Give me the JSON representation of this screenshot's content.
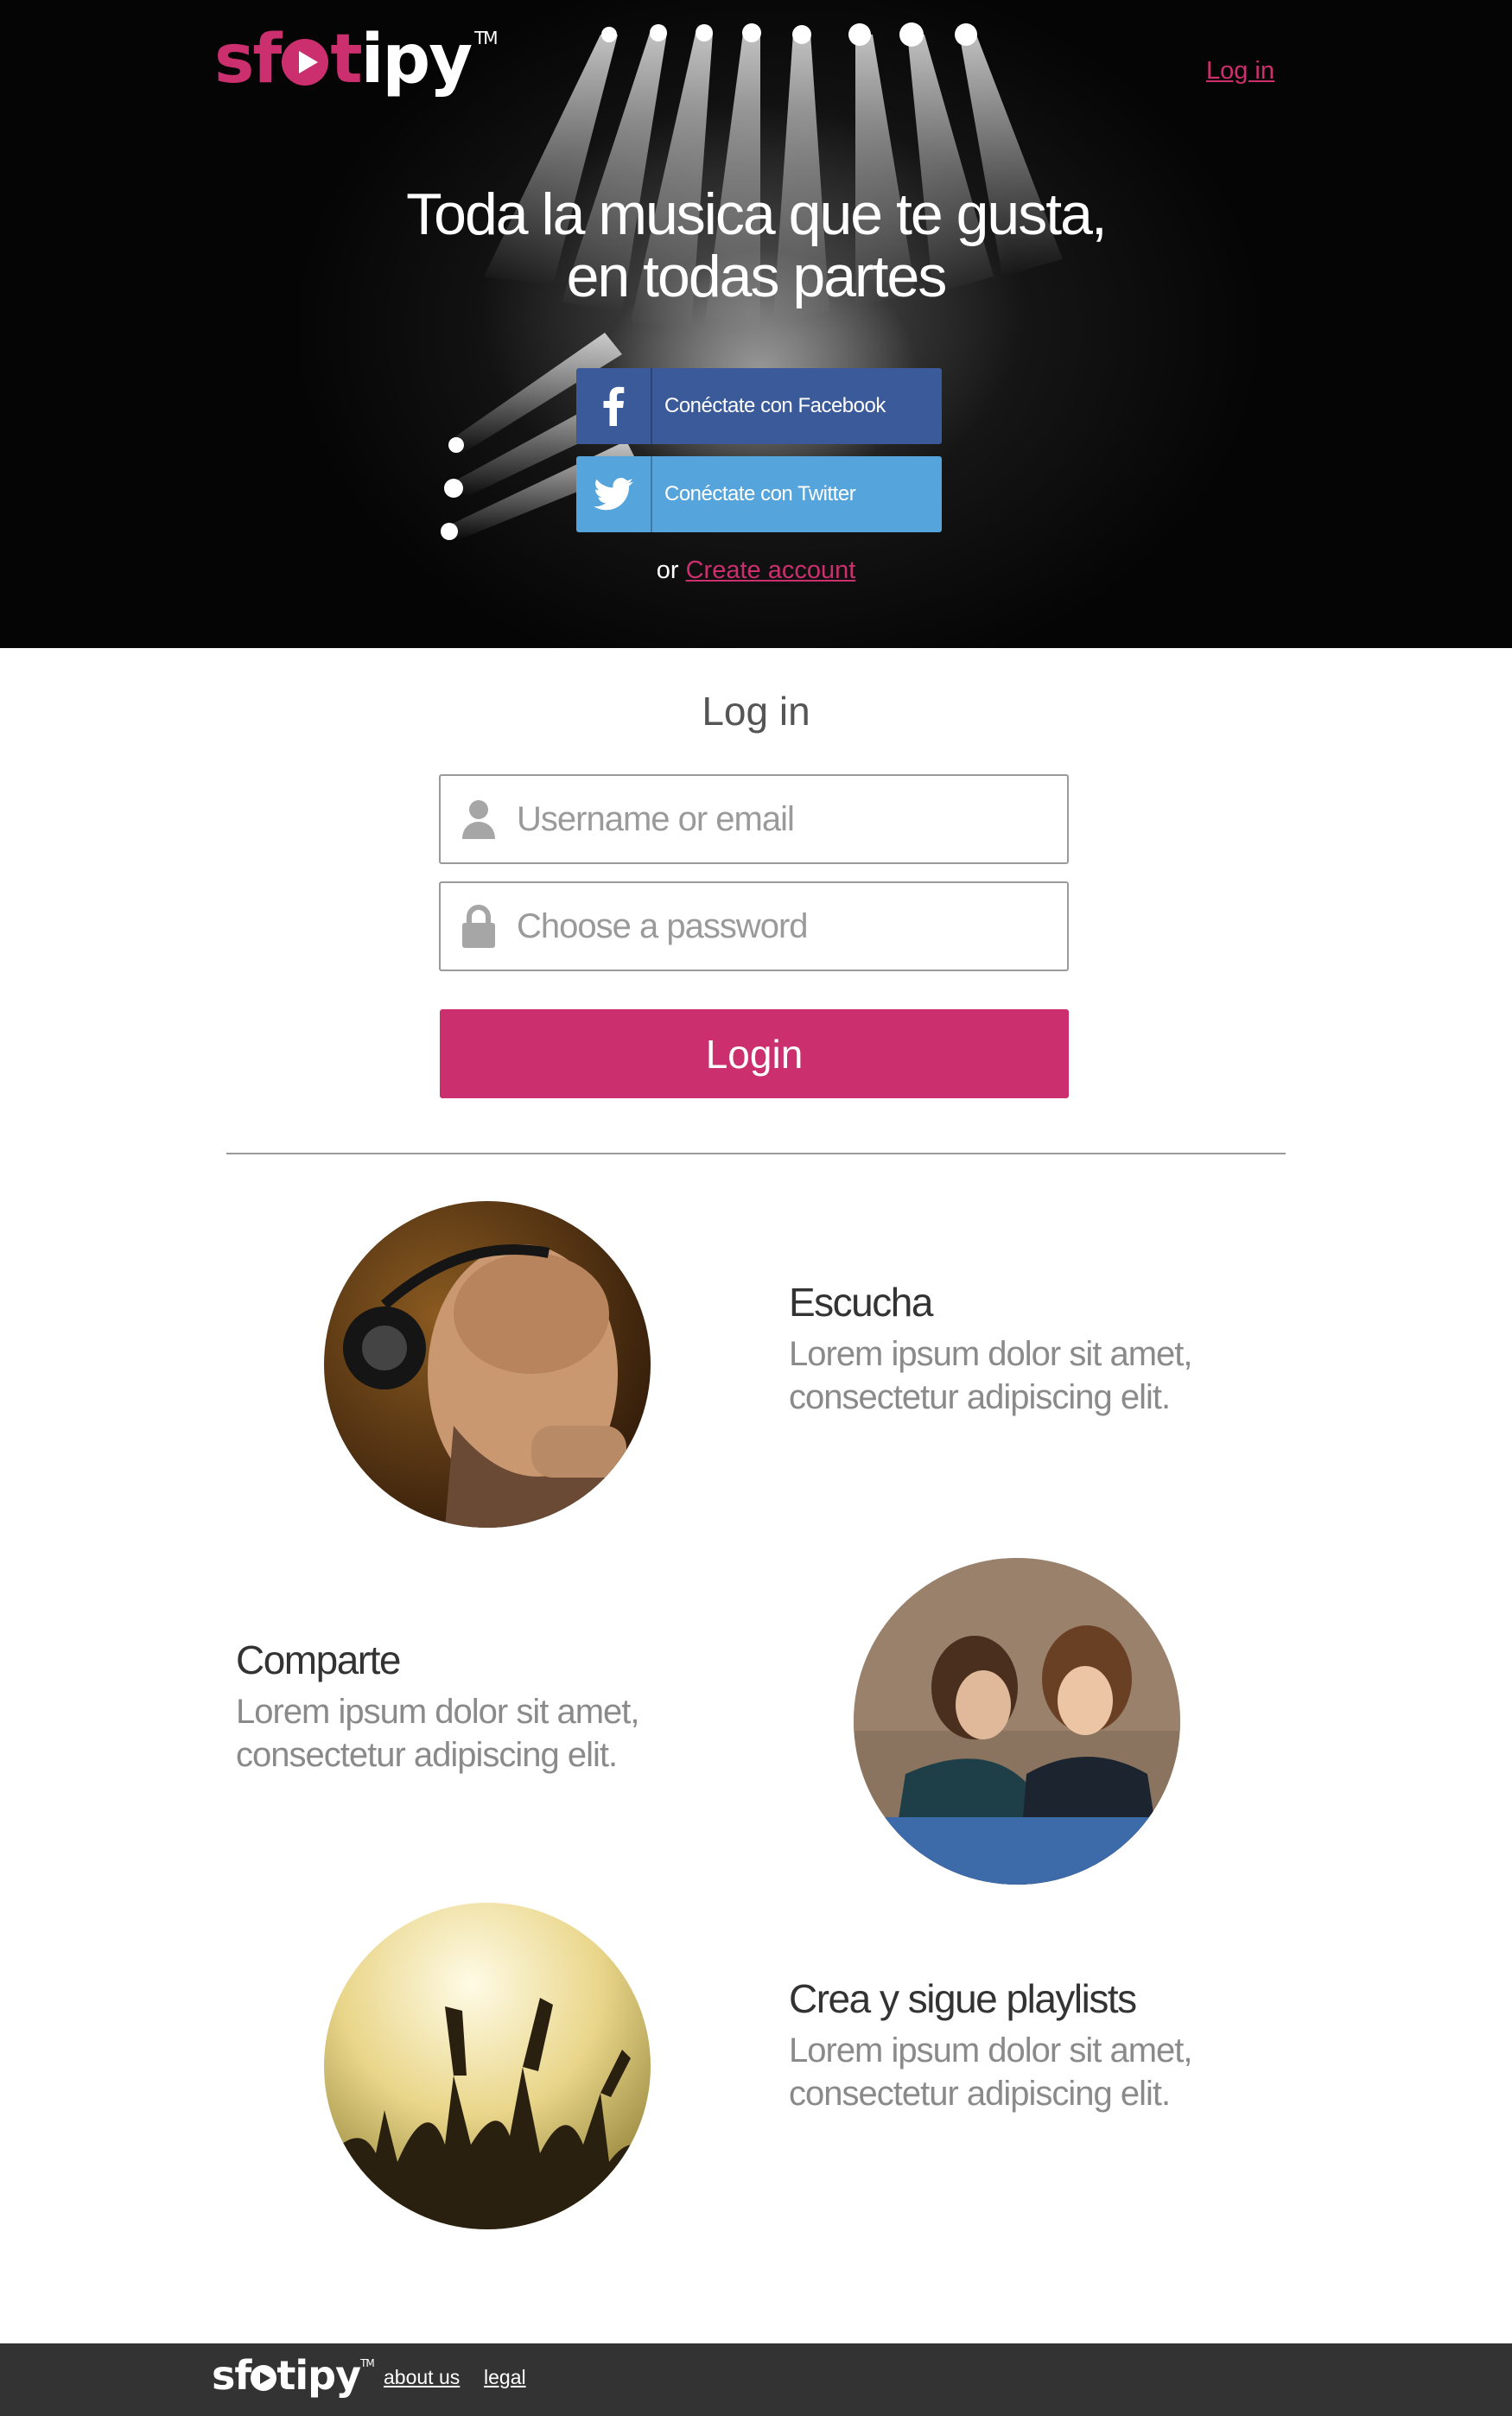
{
  "header": {
    "logo_text_pink": "sf",
    "logo_text_pink2": "t",
    "logo_text_white": "ipy",
    "logo_tm": "TM",
    "login_link": "Log in"
  },
  "hero": {
    "headline_line1": "Toda la musica que te gusta,",
    "headline_line2": "en todas partes",
    "facebook_button": "Conéctate con Facebook",
    "twitter_button": "Conéctate con Twitter",
    "or_text": "or",
    "create_account_link": "Create account"
  },
  "login": {
    "title": "Log in",
    "username_placeholder": "Username or email",
    "password_placeholder": "Choose a password",
    "submit_label": "Login"
  },
  "features": [
    {
      "title": "Escucha",
      "description_line1": "Lorem ipsum dolor sit amet,",
      "description_line2": "consectetur adipiscing elit."
    },
    {
      "title": "Comparte",
      "description_line1": "Lorem ipsum dolor sit amet,",
      "description_line2": "consectetur adipiscing elit."
    },
    {
      "title": "Crea y sigue playlists",
      "description_line1": "Lorem ipsum dolor sit amet,",
      "description_line2": "consectetur adipiscing elit."
    }
  ],
  "footer": {
    "logo_text_a": "sf",
    "logo_text_b": "tipy",
    "logo_tm": "TM",
    "about_link": "about us",
    "legal_link": "legal"
  },
  "colors": {
    "brand_pink": "#cc2f6e",
    "facebook_blue": "#3b5a9a",
    "twitter_blue": "#55a4dc",
    "footer_bg": "#333333"
  },
  "icons": [
    "facebook-icon",
    "twitter-icon",
    "user-icon",
    "lock-icon",
    "play-icon"
  ]
}
